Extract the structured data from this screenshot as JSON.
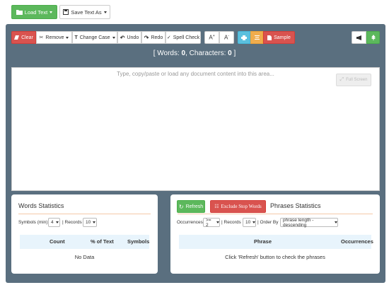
{
  "top_bar": {
    "load_text": "Load Text",
    "save_text_as": "Save Text As"
  },
  "toolbar": {
    "clear": "Clear",
    "remove": "Remove",
    "change_case": "Change Case",
    "undo": "Undo",
    "redo": "Redo",
    "spell_check": "Spell Check",
    "font_increase": "A",
    "font_decrease": "A",
    "sample": "Sample"
  },
  "counter": {
    "open": "[ Words: ",
    "words": "0",
    "mid": ", Characters: ",
    "characters": "0",
    "close": " ]"
  },
  "editor": {
    "placeholder": "Type, copy/paste or load any document content into this area...",
    "full_screen": "Full Screen"
  },
  "words_stats": {
    "title": "Words Statistics",
    "symbols_label": "Symbols (min)",
    "symbols_value": "4",
    "records_label": "| Records",
    "records_value": "10",
    "columns": [
      "Count",
      "% of Text",
      "Symbols"
    ],
    "empty": "No Data"
  },
  "phrases_stats": {
    "refresh": "Refresh",
    "exclude_stop_words": "Exclude Stop Words",
    "title": "Phrases Statistics",
    "occurrences_label": "Occurrences",
    "occurrences_value": ">= 2",
    "records_label": "| Records",
    "records_value": "10",
    "order_label": "| Order By",
    "order_value": "phrase length - descending",
    "columns": [
      "Phrase",
      "Occurrences"
    ],
    "empty": "Click 'Refresh' button to check the phrases"
  },
  "colors": {
    "green": "#5cb85c",
    "red": "#d9534f",
    "blue": "#5bc0de",
    "orange": "#f0ad4e",
    "dark_panel": "#5a6f7f",
    "table_header": "#e8f4fc"
  }
}
